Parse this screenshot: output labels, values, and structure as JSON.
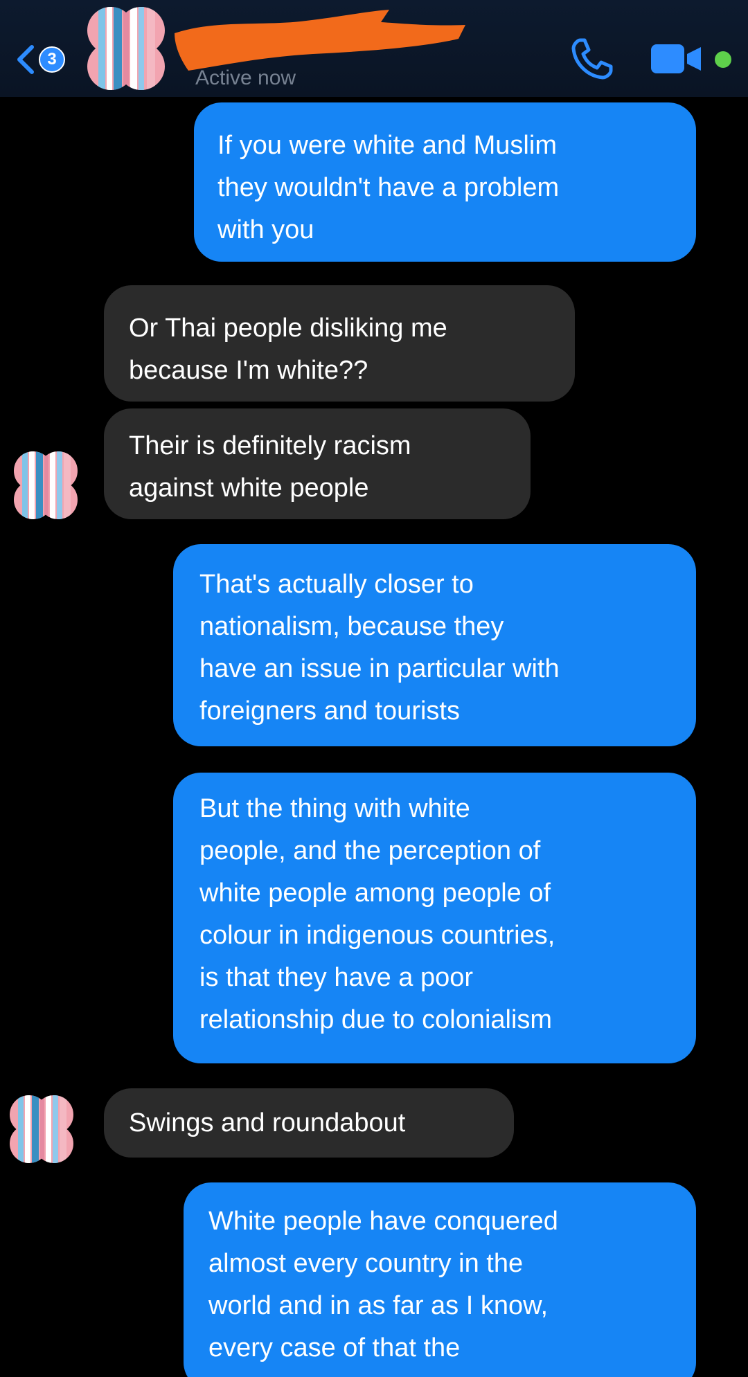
{
  "header": {
    "unread_count": "3",
    "status": "Active now",
    "icons": {
      "back": "chevron-left-icon",
      "call": "phone-icon",
      "video": "video-camera-icon"
    },
    "colors": {
      "header_bg": "#0d1a2e",
      "accent": "#1685f5",
      "online": "#5ed04b",
      "redaction": "#f26a1b"
    }
  },
  "messages": [
    {
      "from": "me",
      "text": "If you were white and Muslim\nthey wouldn't have a problem\nwith you"
    },
    {
      "from": "them",
      "text": "Or Thai people disliking me\nbecause I'm white??"
    },
    {
      "from": "them",
      "text": "Their is definitely racism\nagainst white people"
    },
    {
      "from": "me",
      "text": "That's actually closer to\nnationalism, because they\nhave an issue in particular with\nforeigners and tourists"
    },
    {
      "from": "me",
      "text": "But the thing with white\npeople, and the perception of\nwhite people among people of\ncolour in indigenous countries,\nis that they have a poor\nrelationship  due to colonialism"
    },
    {
      "from": "them",
      "text": "Swings and roundabout"
    },
    {
      "from": "me",
      "text": "White people have conquered\nalmost every country in the\nworld and in as far as I know,\nevery case of that the"
    }
  ],
  "colors": {
    "sent_bubble": "#1685f5",
    "received_bubble": "#2b2b2b",
    "background": "#000000"
  }
}
